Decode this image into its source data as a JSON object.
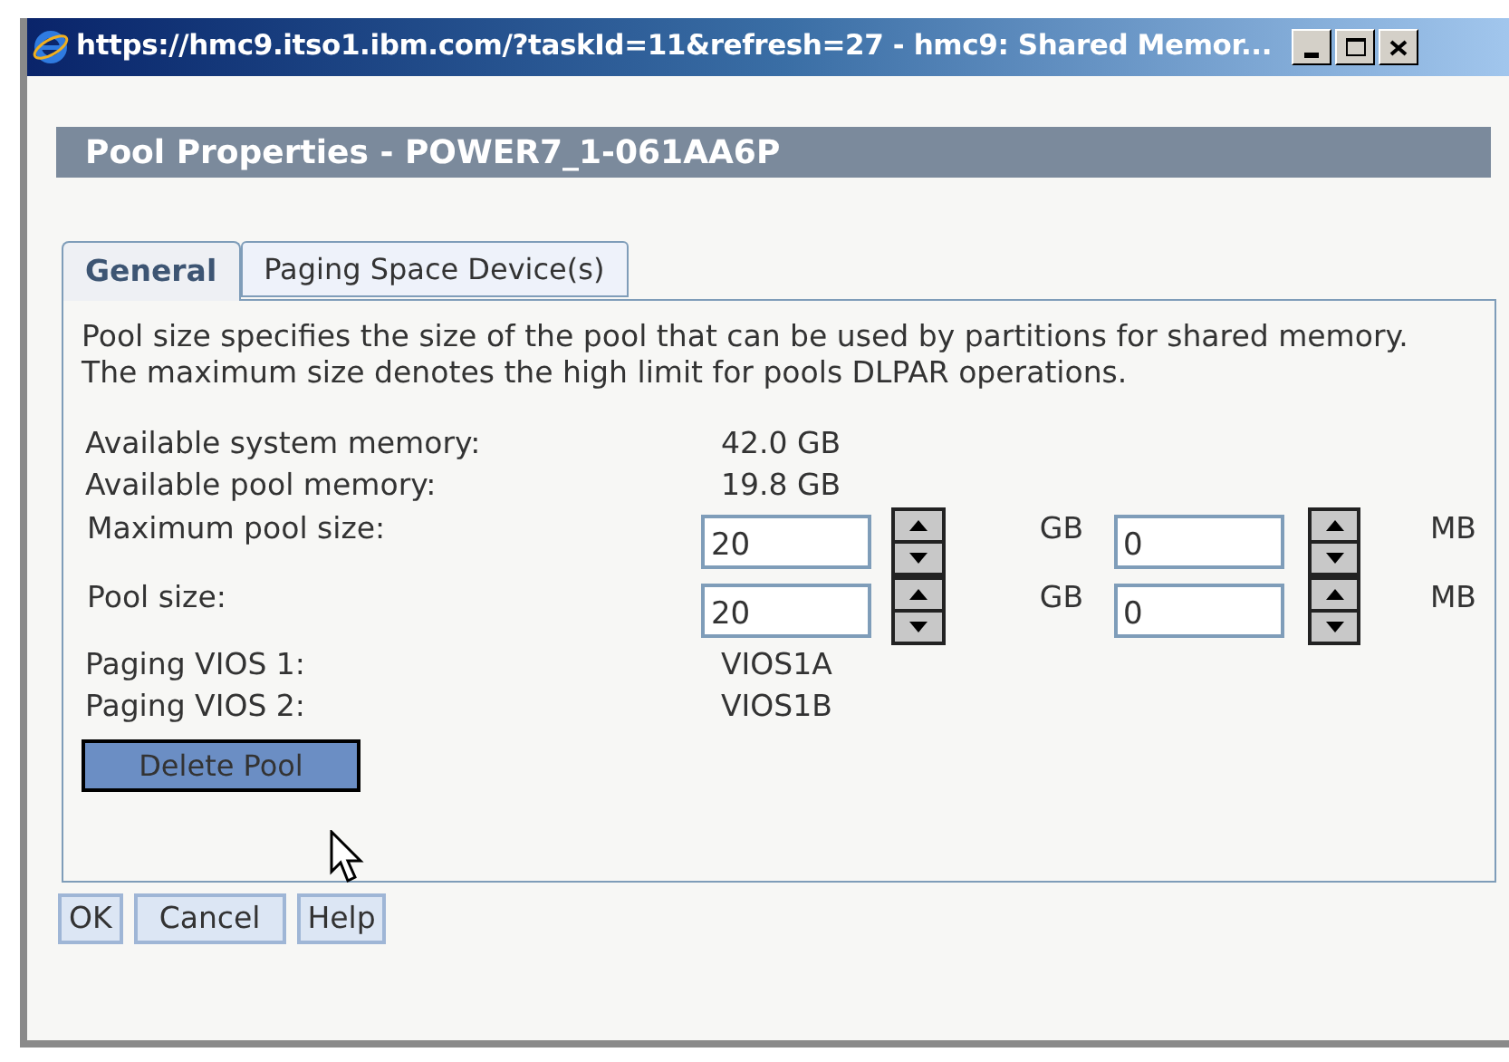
{
  "window": {
    "title": "https://hmc9.itso1.ibm.com/?taskId=11&refresh=27 - hmc9: Shared Memor..."
  },
  "header": "Pool Properties - POWER7_1-061AA6P",
  "tabs": [
    {
      "label": "General",
      "selected": true
    },
    {
      "label": "Paging Space Device(s)",
      "selected": false
    }
  ],
  "description": "Pool size specifies the size of the pool that can be used by partitions for shared memory. The maximum size denotes the high limit for pools DLPAR operations.",
  "rows": [
    {
      "kind": "value",
      "label": "Available system memory:",
      "value": "42.0 GB"
    },
    {
      "kind": "value",
      "label": "Available pool memory:",
      "value": "19.8 GB"
    },
    {
      "kind": "spinner",
      "label": "Maximum pool size:",
      "gb": "20",
      "gb_unit": "GB",
      "mb": "0",
      "mb_unit": "MB"
    },
    {
      "kind": "spinner",
      "label": "Pool size:",
      "gb": "20",
      "gb_unit": "GB",
      "mb": "0",
      "mb_unit": "MB"
    },
    {
      "kind": "value",
      "label": "Paging VIOS 1:",
      "value": "VIOS1A"
    },
    {
      "kind": "value",
      "label": "Paging VIOS 2:",
      "value": "VIOS1B"
    }
  ],
  "delete_button": "Delete Pool",
  "buttons": [
    "OK",
    "Cancel",
    "Help"
  ]
}
